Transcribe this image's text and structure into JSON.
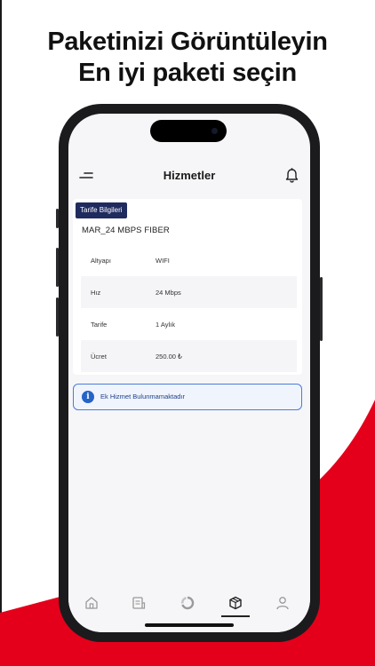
{
  "promo": {
    "headline_line1": "Paketinizi Görüntüleyin",
    "headline_line2": "En iyi paketi seçin",
    "accent_color": "#e4001b"
  },
  "app": {
    "title": "Hizmetler",
    "icons": {
      "menu": "menu-icon",
      "notifications": "bell-icon"
    }
  },
  "tariff": {
    "tag_label": "Tarife Bilgileri",
    "package_name": "MAR_24 MBPS FIBER",
    "rows": [
      {
        "label": "Altyapı",
        "value": "WIFI"
      },
      {
        "label": "Hız",
        "value": "24  Mbps"
      },
      {
        "label": "Tarife",
        "value": "1 Aylık"
      },
      {
        "label": "Ücret",
        "value": "250.00 ₺"
      }
    ]
  },
  "notice": {
    "icon": "info-icon",
    "text": "Ek Hizmet Bulunmamaktadır"
  },
  "tabbar": {
    "items": [
      {
        "name": "home",
        "icon": "home-icon",
        "active": false
      },
      {
        "name": "documents",
        "icon": "document-icon",
        "active": false
      },
      {
        "name": "usage",
        "icon": "usage-chart-icon",
        "active": false
      },
      {
        "name": "services",
        "icon": "package-icon",
        "active": true
      },
      {
        "name": "profile",
        "icon": "profile-icon",
        "active": false
      }
    ]
  }
}
